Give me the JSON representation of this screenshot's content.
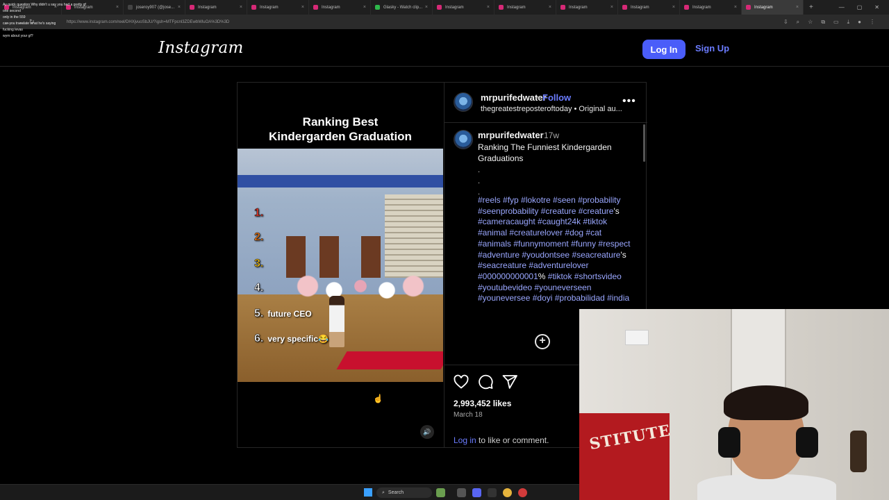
{
  "browser": {
    "tabs": [
      {
        "label": "Instagram",
        "icon": "instagram"
      },
      {
        "label": "Instagram",
        "icon": "instagram"
      },
      {
        "label": "joseroy907 (@jose...",
        "icon": "tiktok"
      },
      {
        "label": "Instagram",
        "icon": "instagram"
      },
      {
        "label": "Instagram",
        "icon": "instagram"
      },
      {
        "label": "Instagram",
        "icon": "instagram"
      },
      {
        "label": "Glasky - Watch clip...",
        "icon": "glasky"
      },
      {
        "label": "Instagram",
        "icon": "instagram"
      },
      {
        "label": "Instagram",
        "icon": "instagram"
      },
      {
        "label": "Instagram",
        "icon": "instagram"
      },
      {
        "label": "Instagram",
        "icon": "instagram"
      },
      {
        "label": "Instagram",
        "icon": "instagram"
      },
      {
        "label": "Instagram",
        "icon": "instagram",
        "active": true
      }
    ],
    "url": "https://www.instagram.com/reel/DHXjvuoSbJU/?igsh=MTFpcnl3ZDEwbWluOA%3D%3D"
  },
  "chat": [
    {
      "user": "",
      "text": "Ay quick question Why didn't u say you had a pretty gf"
    },
    {
      "user": "",
      "text": "one second"
    },
    {
      "user": "",
      "text": "only in the 559"
    },
    {
      "user": "",
      "text": "can you translate what he's saying"
    },
    {
      "user": "",
      "text": "fucking levas"
    },
    {
      "user": "",
      "text": "wym about your gf?"
    }
  ],
  "header": {
    "logo": "Instagram",
    "login_label": "Log In",
    "signup_label": "Sign Up"
  },
  "video": {
    "title_line1": "Ranking Best",
    "title_line2": "Kindergarden Graduation",
    "ranks": [
      {
        "num": "1.",
        "label": ""
      },
      {
        "num": "2.",
        "label": ""
      },
      {
        "num": "3.",
        "label": ""
      },
      {
        "num": "4.",
        "label": ""
      },
      {
        "num": "5.",
        "label": "future CEO"
      },
      {
        "num": "6.",
        "label": "very specific😂"
      }
    ]
  },
  "post": {
    "author": "mrpurifedwater",
    "follow_label": "Follow",
    "dot_sep": "•",
    "audio": "thegreatestreposteroftoday • Original au...",
    "time_ago": "17w",
    "caption": "Ranking The Funniest Kindergarden Graduations",
    "dots": ".\n.\n.",
    "tags_html_parts": [
      {
        "t": "#reels #fyp #lokotre #seen #probability #seenprobability #creature #creature",
        "c": "tag"
      },
      {
        "t": "'s",
        "c": "w"
      },
      {
        "t": " #cameracaught  #caught24k #tiktok #animal #creaturelover #dog #cat #animals #funnymoment #funny #respect #adventure #youdontsee #seacreature",
        "c": "tag"
      },
      {
        "t": "'s",
        "c": "w"
      },
      {
        "t": " #seacreature #adventurelover #000000000001",
        "c": "tag"
      },
      {
        "t": "%",
        "c": "w"
      },
      {
        "t": " #tiktok #shortsvideo #youtubevideo #youneverseen #youneversee #doyi #probabilidad #india",
        "c": "tag"
      }
    ],
    "likes": "2,993,452 likes",
    "date": "March 18",
    "login_link": "Log in",
    "comment_suffix": " to like or comment."
  },
  "taskbar": {
    "search_label": "Search"
  },
  "webcam": {
    "flag_text": "STITUTE"
  },
  "colors": {
    "accent": "#4a5df9",
    "link": "#6b7cff",
    "hashtag": "#9aa7ff"
  }
}
